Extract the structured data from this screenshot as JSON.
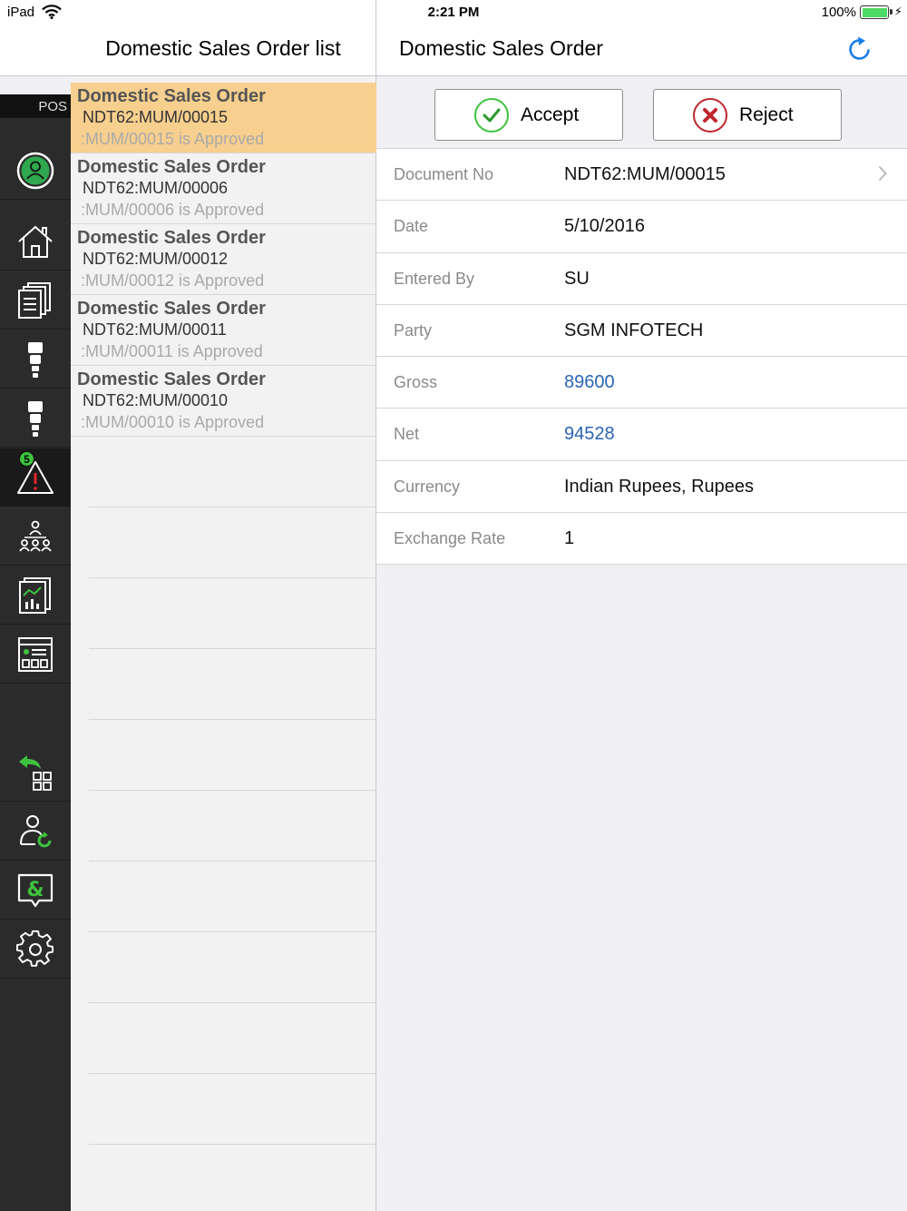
{
  "status_bar": {
    "device": "iPad",
    "time": "2:21 PM",
    "battery": "100%"
  },
  "rail": {
    "header": "POS",
    "items": [
      {
        "icon": "user-circle-icon"
      },
      {
        "icon": "home-icon"
      },
      {
        "icon": "documents-icon"
      },
      {
        "icon": "flow-icon"
      },
      {
        "icon": "flow-icon"
      },
      {
        "icon": "alert-icon",
        "badge": "5",
        "active": true
      },
      {
        "icon": "org-chart-icon"
      },
      {
        "icon": "report-chart-icon"
      },
      {
        "icon": "dashboard-icon"
      },
      {
        "icon": "back-to-apps-icon"
      },
      {
        "icon": "user-refresh-icon"
      },
      {
        "icon": "chat-icon"
      },
      {
        "icon": "gear-icon"
      }
    ]
  },
  "list": {
    "title": "Domestic Sales Order list",
    "items": [
      {
        "title": "Domestic Sales Order",
        "doc": "NDT62:MUM/00015",
        "status": ":MUM/00015 is Approved",
        "selected": true
      },
      {
        "title": "Domestic Sales Order",
        "doc": "NDT62:MUM/00006",
        "status": ":MUM/00006 is Approved"
      },
      {
        "title": "Domestic Sales Order",
        "doc": "NDT62:MUM/00012",
        "status": ":MUM/00012 is Approved"
      },
      {
        "title": "Domestic Sales Order",
        "doc": "NDT62:MUM/00011",
        "status": ":MUM/00011 is Approved"
      },
      {
        "title": "Domestic Sales Order",
        "doc": "NDT62:MUM/00010",
        "status": ":MUM/00010 is Approved"
      }
    ]
  },
  "detail": {
    "title": "Domestic Sales Order",
    "accept_label": "Accept",
    "reject_label": "Reject",
    "fields": [
      {
        "label": "Document No",
        "value": "NDT62:MUM/00015",
        "chevron": true
      },
      {
        "label": "Date",
        "value": "5/10/2016"
      },
      {
        "label": "Entered By",
        "value": "SU"
      },
      {
        "label": "Party",
        "value": "SGM INFOTECH"
      },
      {
        "label": "Gross",
        "value": "89600",
        "link": true
      },
      {
        "label": "Net",
        "value": "94528",
        "link": true
      },
      {
        "label": "Currency",
        "value": "Indian Rupees, Rupees"
      },
      {
        "label": "Exchange Rate",
        "value": "1"
      }
    ]
  },
  "colors": {
    "selected_row": "#f7cf8e",
    "accent_green": "#3ec33e",
    "reject_red": "#c0262d",
    "link_blue": "#2a64b4",
    "rail_bg": "#2b2b2b"
  }
}
